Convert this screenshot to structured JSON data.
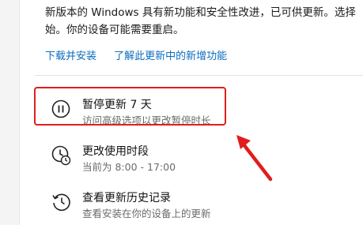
{
  "description": {
    "line1": "新版本的 Windows 具有新功能和安全性改进，已可供更新。选择",
    "line2": "始。你的设备可能需要重启。"
  },
  "links": {
    "download": "下载并安装",
    "learn_more": "了解此更新中的新增功能"
  },
  "options": {
    "pause": {
      "title": "暂停更新 7 天",
      "subtitle": "访问高级选项以更改暂停时长",
      "icon": "pause-icon"
    },
    "active_hours": {
      "title": "更改使用时段",
      "subtitle": "当前为 8:00 - 17:00",
      "icon": "clock-icon"
    },
    "history": {
      "title": "查看更新历史记录",
      "subtitle": "查看安装在你的设备上的更新",
      "icon": "history-icon"
    }
  },
  "colors": {
    "link": "#0a6cbf",
    "annotation": "#e11d1d"
  }
}
